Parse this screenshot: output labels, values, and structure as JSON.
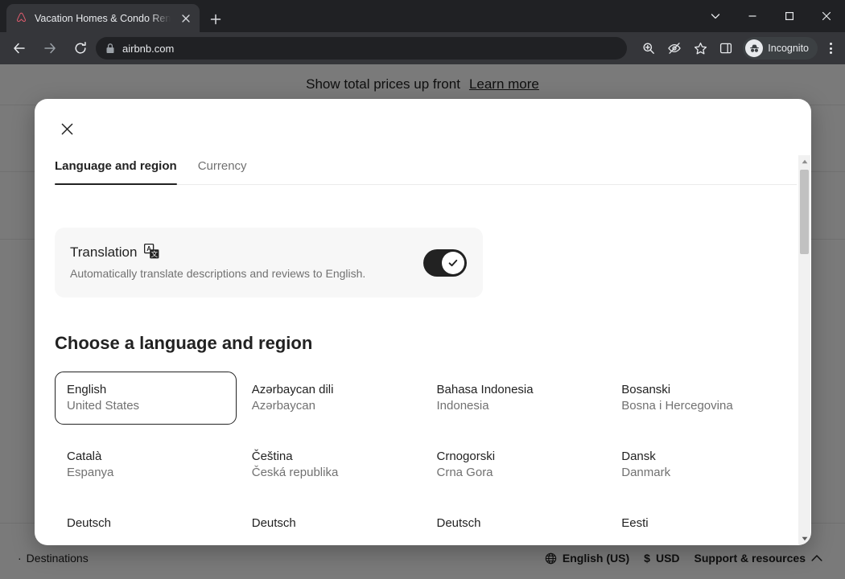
{
  "browser": {
    "tab": {
      "title": "Vacation Homes & Condo Rentals - Airbnb",
      "favicon_icon": "airbnb-logo-icon",
      "close_icon": "close-icon"
    },
    "new_tab_icon": "plus-icon",
    "window_controls": {
      "tab_search_icon": "chevron-down-icon",
      "minimize_icon": "minimize-icon",
      "maximize_icon": "maximize-icon",
      "close_icon": "close-icon"
    },
    "toolbar": {
      "back_icon": "back-arrow-icon",
      "forward_icon": "forward-arrow-icon",
      "reload_icon": "reload-icon",
      "lock_icon": "lock-icon",
      "url": "airbnb.com",
      "zoom_icon": "zoom-icon",
      "tracking_protection_icon": "eye-slash-icon",
      "bookmark_icon": "star-icon",
      "side_panel_icon": "side-panel-icon",
      "profile_icon": "incognito-icon",
      "profile_label": "Incognito",
      "menu_icon": "three-dots-icon"
    }
  },
  "page": {
    "banner": {
      "text": "Show total prices up front",
      "link": "Learn more"
    },
    "footer": {
      "destinations": "Destinations",
      "destinations_bullet": "·",
      "globe_icon": "globe-icon",
      "language": "English (US)",
      "currency_symbol": "$",
      "currency": "USD",
      "support": "Support & resources",
      "support_chevron_icon": "chevron-up-icon"
    }
  },
  "modal": {
    "close_icon": "close-icon",
    "tabs": [
      {
        "label": "Language and region",
        "active": true
      },
      {
        "label": "Currency",
        "active": false
      }
    ],
    "translation": {
      "title": "Translation",
      "icon": "translate-icon",
      "emoji": "🈂",
      "description": "Automatically translate descriptions and reviews to English.",
      "toggle_on": true,
      "toggle_check_icon": "check-icon"
    },
    "section_title": "Choose a language and region",
    "languages": [
      {
        "name": "English",
        "region": "United States",
        "selected": true
      },
      {
        "name": "Azərbaycan dili",
        "region": "Azərbaycan",
        "selected": false
      },
      {
        "name": "Bahasa Indonesia",
        "region": "Indonesia",
        "selected": false
      },
      {
        "name": "Bosanski",
        "region": "Bosna i Hercegovina",
        "selected": false
      },
      {
        "name": "Català",
        "region": "Espanya",
        "selected": false
      },
      {
        "name": "Čeština",
        "region": "Česká republika",
        "selected": false
      },
      {
        "name": "Crnogorski",
        "region": "Crna Gora",
        "selected": false
      },
      {
        "name": "Dansk",
        "region": "Danmark",
        "selected": false
      },
      {
        "name": "Deutsch",
        "region": "",
        "selected": false
      },
      {
        "name": "Deutsch",
        "region": "",
        "selected": false
      },
      {
        "name": "Deutsch",
        "region": "",
        "selected": false
      },
      {
        "name": "Eesti",
        "region": "",
        "selected": false
      }
    ],
    "scrollbar": {
      "up_arrow_icon": "triangle-up-icon",
      "down_arrow_icon": "triangle-down-icon"
    }
  }
}
